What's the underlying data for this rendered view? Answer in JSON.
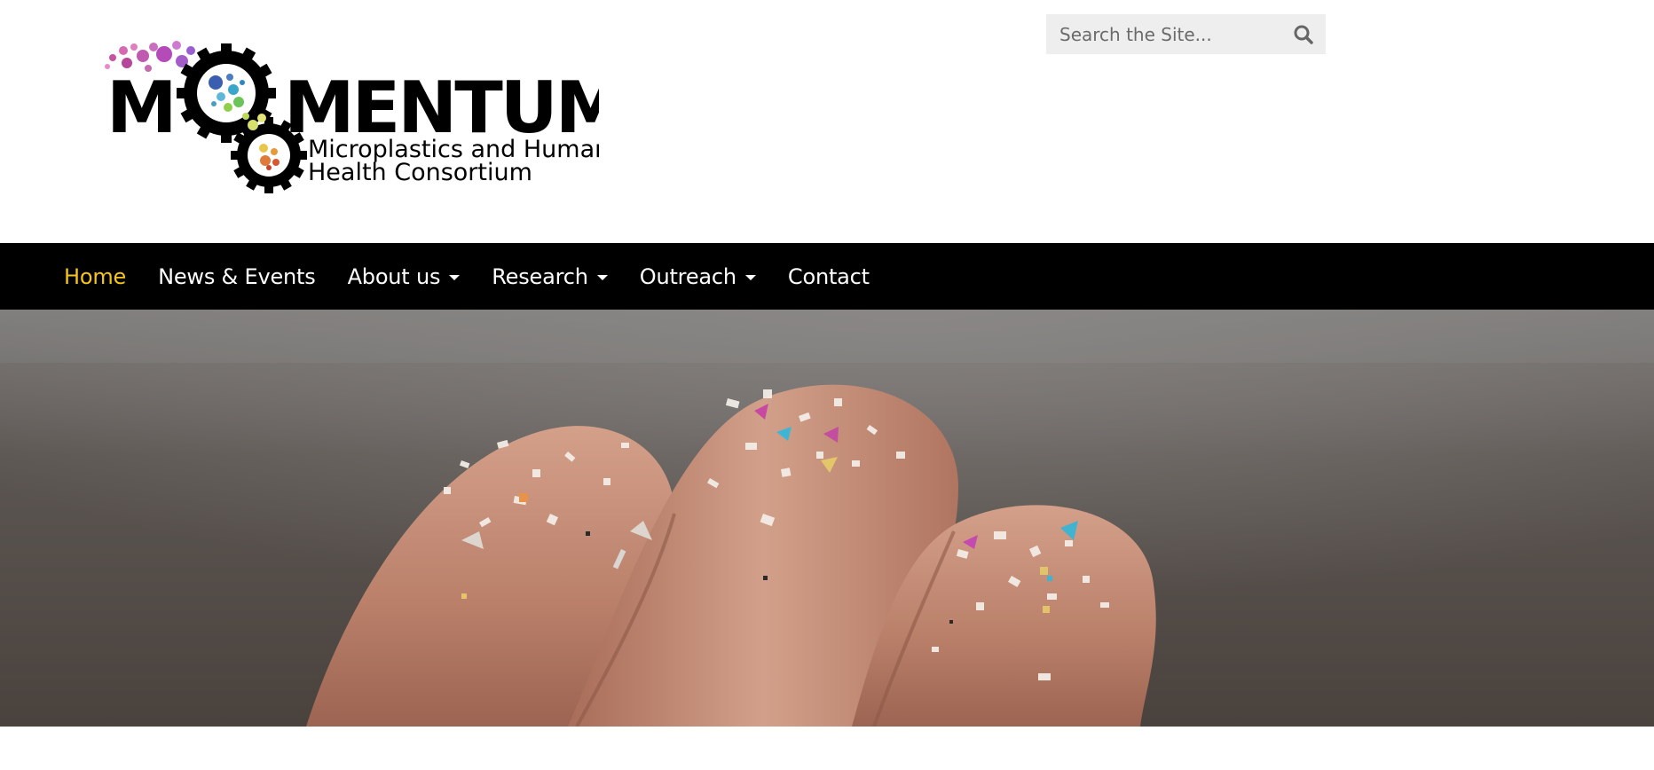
{
  "logo": {
    "wordmark": "MOMENTUM",
    "tagline_line1": "Microplastics and Human",
    "tagline_line2": "Health Consortium"
  },
  "search": {
    "placeholder": "Search the Site...",
    "value": "",
    "icon": "search-icon"
  },
  "nav": {
    "items": [
      {
        "label": "Home",
        "active": true,
        "dropdown": false
      },
      {
        "label": "News & Events",
        "active": false,
        "dropdown": false
      },
      {
        "label": "About us",
        "active": false,
        "dropdown": true
      },
      {
        "label": "Research",
        "active": false,
        "dropdown": true
      },
      {
        "label": "Outreach",
        "active": false,
        "dropdown": true
      },
      {
        "label": "Contact",
        "active": false,
        "dropdown": false
      }
    ],
    "active_color": "#f5c518"
  },
  "hero": {
    "subject": "fingertips covered in microplastic particles"
  }
}
